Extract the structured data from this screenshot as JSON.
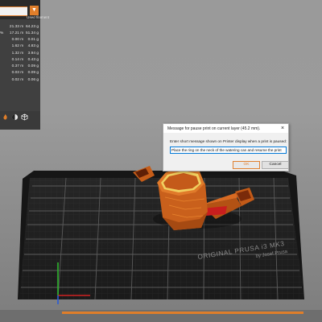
{
  "left_panel": {
    "stats_header": "Used filament",
    "rows": [
      {
        "mark": "",
        "length": "21.33 m",
        "weight": "64.23 g"
      },
      {
        "mark": "%",
        "length": "17.21 m",
        "weight": "51.34 g"
      },
      {
        "mark": "",
        "length": "0.00 m",
        "weight": "0.01 g"
      },
      {
        "mark": "",
        "length": "1.62 m",
        "weight": "4.83 g"
      },
      {
        "mark": "",
        "length": "1.32 m",
        "weight": "3.94 g"
      },
      {
        "mark": "",
        "length": "0.14 m",
        "weight": "0.43 g"
      },
      {
        "mark": "",
        "length": "0.37 m",
        "weight": "0.09 g"
      },
      {
        "mark": "",
        "length": "0.03 m",
        "weight": "0.09 g"
      },
      {
        "mark": "",
        "length": "0.02 m",
        "weight": "0.06 g"
      }
    ],
    "footer_icons": [
      "flame-icon",
      "palette-icon",
      "cube-icon"
    ]
  },
  "bed": {
    "brand_line1": "ORIGINAL PRUSA i3 MK3",
    "brand_line2": "by Josef Prusa"
  },
  "colors": {
    "accent": "#e08030",
    "model": "#d2691e",
    "bed_surface": "#1f1f1f",
    "background": "#9a9a9a"
  },
  "dialog": {
    "title": "Message for pause print on current layer (45.2 mm).",
    "close_label": "×",
    "prompt": "Enter short message shown on Printer display when a print is paused:",
    "input_value": "Place the ring on the neck of the watering can and resume the print",
    "ok_label": "OK",
    "cancel_label": "Cancel"
  }
}
